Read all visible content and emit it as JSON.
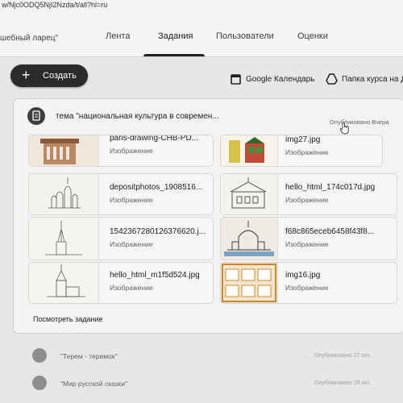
{
  "browser": {
    "url": "w/Njc0ODQ5NjI2Nzda/t/all?hl=ru"
  },
  "header": {
    "class_name": "шебный ларец\"",
    "tabs": [
      {
        "label": "Лента"
      },
      {
        "label": "Задания"
      },
      {
        "label": "Пользователи"
      },
      {
        "label": "Оценки"
      }
    ]
  },
  "toolbar": {
    "create_label": "Создать",
    "calendar_label": "Google Календарь",
    "drive_label": "Папка курса на Д"
  },
  "topic": {
    "title": "тема \"национальная культура в современ...",
    "published": "Опубликовано Вчера",
    "attachments": [
      {
        "name": "paris-drawing-CHB-PD...",
        "type": "Изображение"
      },
      {
        "name": "img27.jpg",
        "type": "Изображение"
      },
      {
        "name": "depositphotos_1908516...",
        "type": "Изображение"
      },
      {
        "name": "hello_html_174c017d.jpg",
        "type": "Изображение"
      },
      {
        "name": "1542367280126376620.j...",
        "type": "Изображение"
      },
      {
        "name": "f68c865eceb6458f43f8...",
        "type": "Изображение"
      },
      {
        "name": "hello_html_m1f5d524.jpg",
        "type": "Изображение"
      },
      {
        "name": "img16.jpg",
        "type": "Изображение"
      }
    ],
    "view_task_label": "Посмотреть задание"
  },
  "stream": [
    {
      "title": "\"Терем - теремок\"",
      "time": "Опубликовано 27 окт."
    },
    {
      "title": "\"Мир русской сказки\"",
      "time": "Опубликовано 26 окт."
    }
  ]
}
